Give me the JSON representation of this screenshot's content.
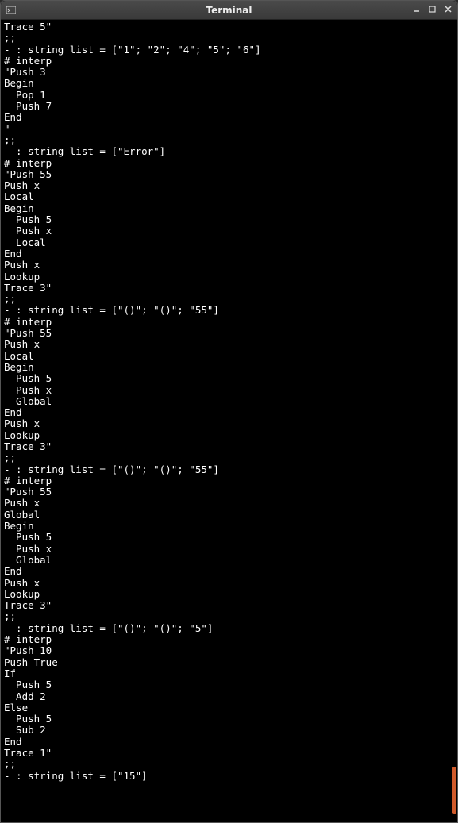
{
  "window": {
    "title": "Terminal"
  },
  "terminal": {
    "lines": [
      "Trace 5\"",
      ";;",
      "- : string list = [\"1\"; \"2\"; \"4\"; \"5\"; \"6\"]",
      "# interp",
      "\"Push 3",
      "Begin",
      "  Pop 1",
      "  Push 7",
      "End",
      "\"",
      ";;",
      "- : string list = [\"Error\"]",
      "# interp",
      "\"Push 55",
      "Push x",
      "Local",
      "Begin",
      "  Push 5",
      "  Push x",
      "  Local",
      "End",
      "Push x",
      "Lookup",
      "Trace 3\"",
      ";;",
      "- : string list = [\"()\"; \"()\"; \"55\"]",
      "# interp",
      "\"Push 55",
      "Push x",
      "Local",
      "Begin",
      "  Push 5",
      "  Push x",
      "  Global",
      "End",
      "Push x",
      "Lookup",
      "Trace 3\"",
      ";;",
      "- : string list = [\"()\"; \"()\"; \"55\"]",
      "# interp",
      "\"Push 55",
      "Push x",
      "Global",
      "Begin",
      "  Push 5",
      "  Push x",
      "  Global",
      "End",
      "Push x",
      "Lookup",
      "Trace 3\"",
      ";;",
      "- : string list = [\"()\"; \"()\"; \"5\"]",
      "# interp",
      "\"Push 10",
      "Push True",
      "If",
      "  Push 5",
      "  Add 2",
      "Else",
      "  Push 5",
      "  Sub 2",
      "End",
      "Trace 1\"",
      ";;",
      "- : string list = [\"15\"]"
    ]
  }
}
